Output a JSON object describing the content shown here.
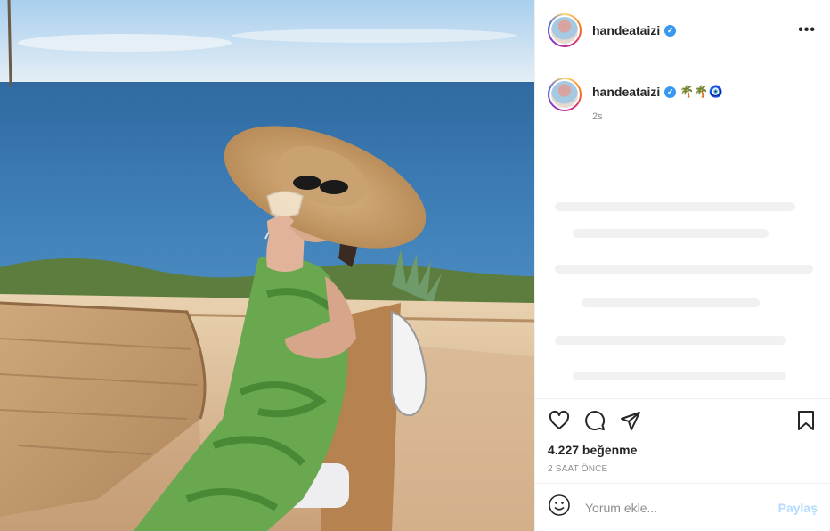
{
  "post": {
    "image_alt": "",
    "header": {
      "username": "handeataizi",
      "verified_icon": "verified-badge-icon",
      "more_icon": "more-options-icon"
    },
    "caption": {
      "username": "handeataizi",
      "emojis": "🌴🌴🧿",
      "time": "2s"
    },
    "actions": {
      "like_icon": "heart-icon",
      "comment_icon": "comment-bubble-icon",
      "share_icon": "paper-plane-icon",
      "save_icon": "bookmark-icon"
    },
    "likes": "4.227 beğenme",
    "time_ago": "2 SAAT ÖNCE",
    "comment_input": {
      "placeholder": "Yorum ekle...",
      "emoji_icon": "smiley-icon",
      "share_label": "Paylaş"
    }
  },
  "colors": {
    "accent": "#3897f0",
    "share_disabled": "#b3dbff",
    "muted": "#8e8e8e",
    "text": "#262626",
    "border": "#efefef"
  }
}
